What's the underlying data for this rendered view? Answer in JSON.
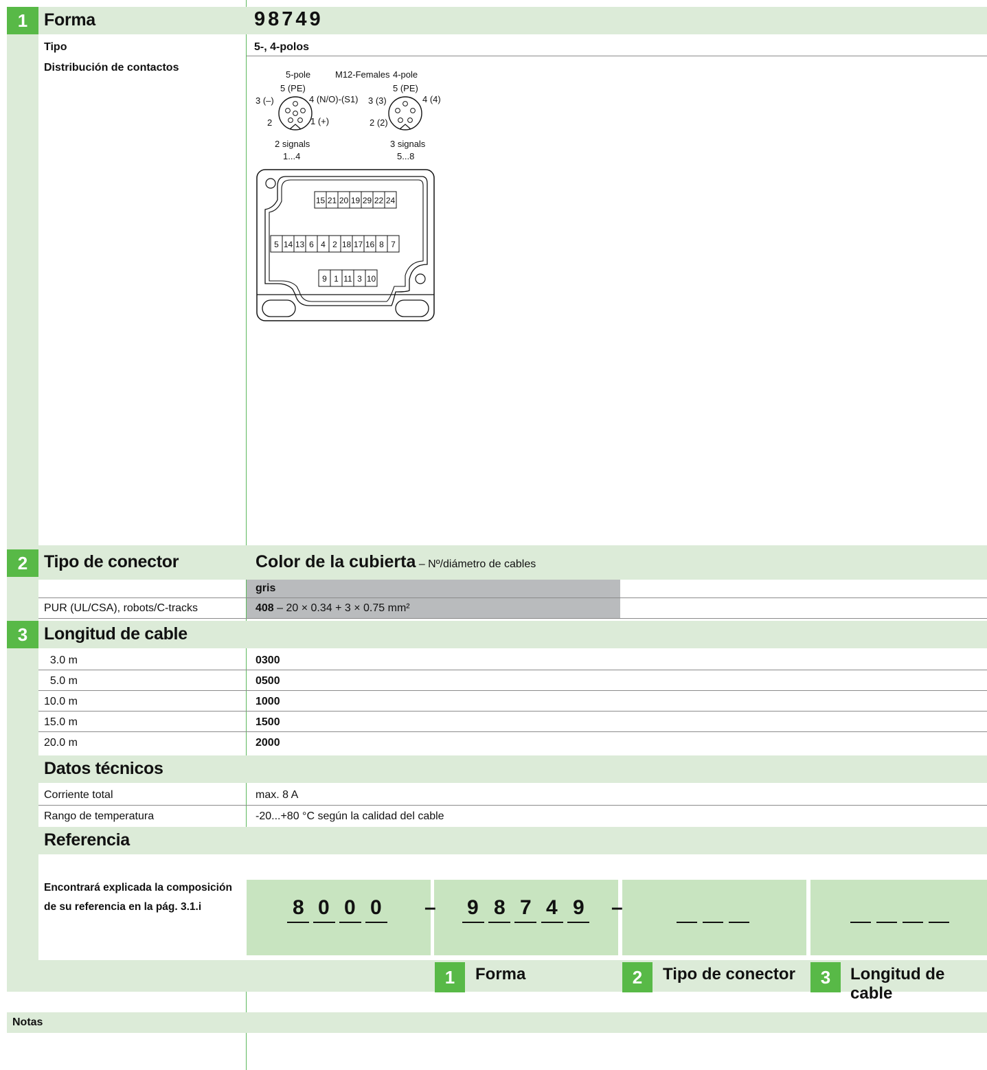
{
  "section1": {
    "number": "1",
    "title": "Forma",
    "product_code": "98749",
    "tipo_label": "Tipo",
    "tipo_value": "5-, 4-polos",
    "contactos_label": "Distribución de contactos"
  },
  "diagram": {
    "title_5pole": "5-pole",
    "title_m12": "M12-Females",
    "title_4pole": "4-pole",
    "p5_top": "5 (PE)",
    "p5_left": "3 (–)",
    "p5_right": "4 (N/O)-(S1)",
    "p5_bl": "2",
    "p5_br": "1 (+)",
    "p5_sig": "2 signals",
    "p5_range": "1...4",
    "p4_top": "5 (PE)",
    "p4_left": "3 (3)",
    "p4_right": "4 (4)",
    "p4_bl": "2 (2)",
    "p4_sig": "3 signals",
    "p4_range": "5...8",
    "row1": [
      "15",
      "21",
      "20",
      "19",
      "29",
      "22",
      "24"
    ],
    "row2": [
      "5",
      "14",
      "13",
      "6",
      "4",
      "2",
      "18",
      "17",
      "16",
      "8",
      "7"
    ],
    "row3": [
      "9",
      "1",
      "11",
      "3",
      "10"
    ]
  },
  "section2": {
    "number": "2",
    "title": "Tipo de conector",
    "color_title": "Color de la cubierta",
    "color_sub": " – Nº/diámetro de cables",
    "color_name": "gris",
    "cable_label": "PUR (UL/CSA), robots/C-tracks",
    "cable_code": "408",
    "cable_spec": " – 20 × 0.34 + 3 × 0.75 mm²"
  },
  "section3": {
    "number": "3",
    "title": "Longitud de cable",
    "rows": [
      {
        "length": "  3.0 m",
        "code": "0300"
      },
      {
        "length": "  5.0 m",
        "code": "0500"
      },
      {
        "length": "10.0 m",
        "code": "1000"
      },
      {
        "length": "15.0 m",
        "code": "1500"
      },
      {
        "length": "20.0 m",
        "code": "2000"
      }
    ]
  },
  "datos": {
    "title": "Datos técnicos",
    "rows": [
      {
        "label": "Corriente total",
        "value": "max. 8 A"
      },
      {
        "label": "Rango de temperatura",
        "value": "-20...+80 °C según la calidad del cable"
      }
    ]
  },
  "referencia": {
    "title": "Referencia",
    "note_line1": "Encontrará explicada la composición",
    "note_line2": "de su referencia en la pág. 3.1.i",
    "prefix_digits": [
      "8",
      "0",
      "0",
      "0"
    ],
    "dash": "–",
    "forma_digits": [
      "9",
      "8",
      "7",
      "4",
      "9"
    ],
    "legend": [
      {
        "number": "1",
        "label": "Forma"
      },
      {
        "number": "2",
        "label": "Tipo de conector"
      },
      {
        "number": "3",
        "label": "Longitud de cable"
      }
    ]
  },
  "notas": {
    "label": "Notas"
  }
}
